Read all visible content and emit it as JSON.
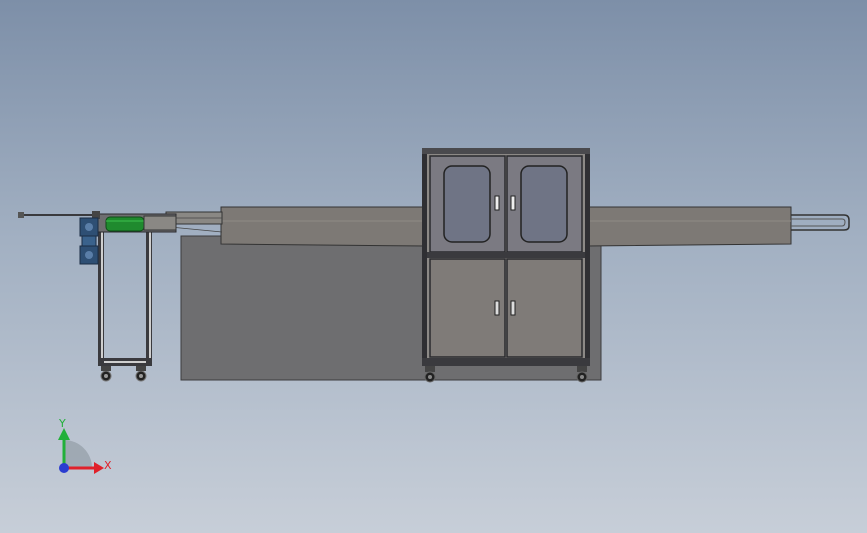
{
  "triad": {
    "x_label": "X",
    "y_label": "Y"
  },
  "colors": {
    "background_top": "#7d8fa8",
    "background_bottom": "#c7ced8",
    "frame_dark": "#2f2f33",
    "panel_gray": "#7f7b78",
    "window_blue": "#6f7485",
    "belt_green": "#1f8a2e",
    "motor_blue": "#2e4f74",
    "axis_x": "#e0202a",
    "axis_y": "#22b03a",
    "axis_z": "#2a3cd0"
  }
}
